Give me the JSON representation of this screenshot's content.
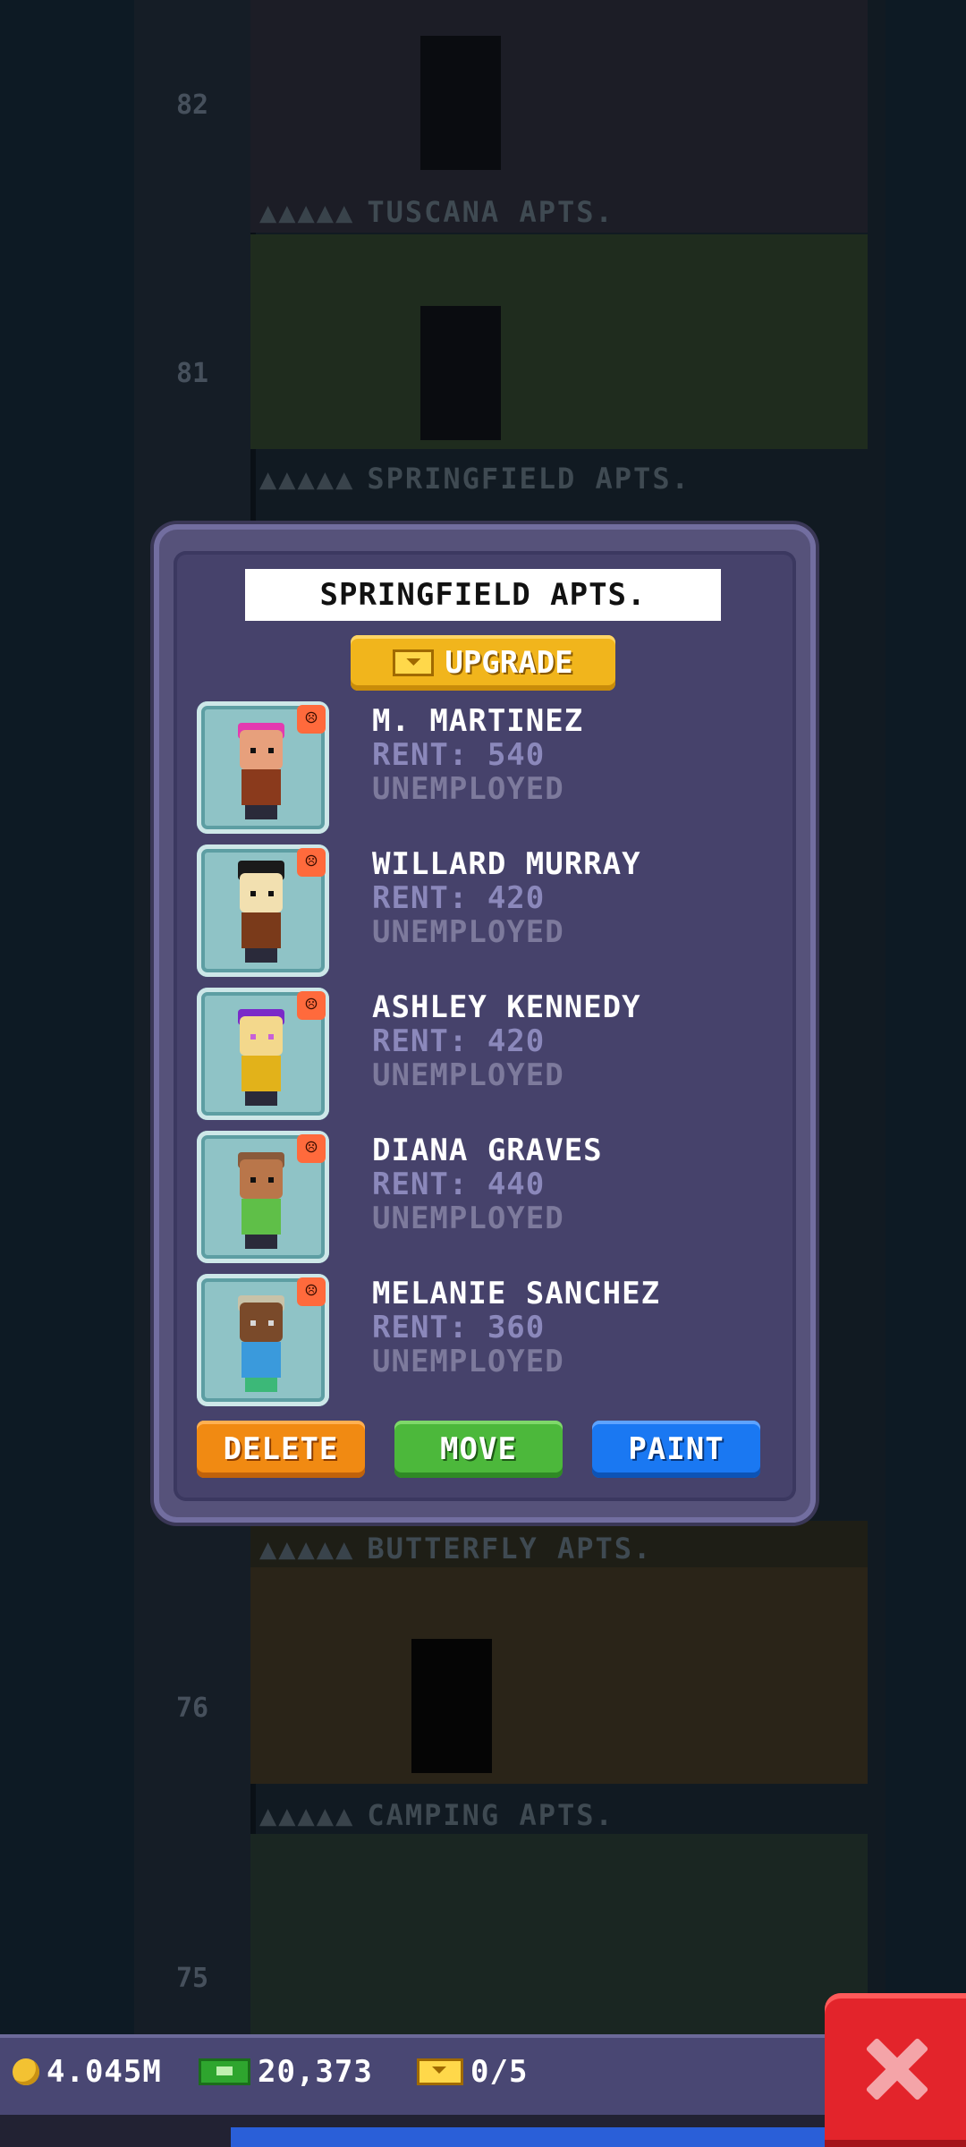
{
  "tower": {
    "floors": [
      {
        "number": "82",
        "label": "TUSCANA APTS."
      },
      {
        "number": "81",
        "label": "SPRINGFIELD APTS."
      },
      {
        "number": "",
        "label": "BUTTERFLY APTS."
      },
      {
        "number": "76",
        "label": "CAMPING APTS."
      },
      {
        "number": "75",
        "label": ""
      }
    ],
    "label_dots": "▲▲▲▲▲"
  },
  "dialog": {
    "title": "SPRINGFIELD APTS.",
    "upgrade_label": "UPGRADE",
    "residents": [
      {
        "name": "M. MARTINEZ",
        "rent": "RENT: 540",
        "job": "UNEMPLOYED",
        "mood": "☹",
        "hair": "#e33ab0",
        "skin": "#e7a07c",
        "shirt": "#8a3a1c"
      },
      {
        "name": "WILLARD MURRAY",
        "rent": "RENT: 420",
        "job": "UNEMPLOYED",
        "mood": "☹",
        "hair": "#1a1a1a",
        "skin": "#f2e0b0",
        "shirt": "#7a3a1a"
      },
      {
        "name": "ASHLEY KENNEDY",
        "rent": "RENT: 420",
        "job": "UNEMPLOYED",
        "mood": "☹",
        "hair": "#7a2ac8",
        "skin": "#f3d88c",
        "shirt": "#e2b21a"
      },
      {
        "name": "DIANA GRAVES",
        "rent": "RENT: 440",
        "job": "UNEMPLOYED",
        "mood": "☹",
        "hair": "#8a5a3a",
        "skin": "#b9764a",
        "shirt": "#5fbf48"
      },
      {
        "name": "MELANIE SANCHEZ",
        "rent": "RENT: 360",
        "job": "UNEMPLOYED",
        "mood": "☹",
        "hair": "#c8c2a8",
        "skin": "#7a4a2a",
        "shirt": "#3a9adc"
      }
    ],
    "buttons": {
      "delete": "DELETE",
      "move": "MOVE",
      "paint": "PAINT"
    }
  },
  "status": {
    "coins": "4.045M",
    "bux_cash": "20,373",
    "tickets": "0/5"
  }
}
